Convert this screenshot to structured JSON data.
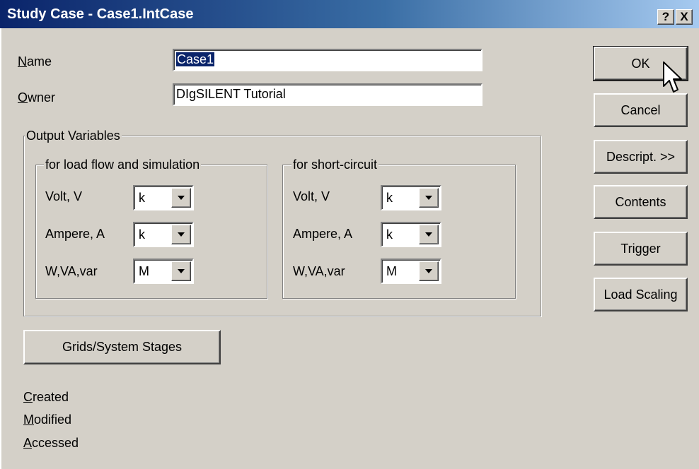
{
  "window": {
    "title": "Study Case - Case1.IntCase",
    "help_label": "?",
    "close_label": "X"
  },
  "fields": {
    "name": {
      "label_mnemonic": "N",
      "label_rest": "ame",
      "value": "Case1"
    },
    "owner": {
      "label_mnemonic": "O",
      "label_rest": "wner",
      "value": "DIgSILENT Tutorial"
    }
  },
  "output_variables": {
    "title": "Output Variables",
    "load_flow": {
      "title": "for load flow and simulation",
      "rows": [
        {
          "label": "Volt, V",
          "value": "k"
        },
        {
          "label": "Ampere, A",
          "value": "k"
        },
        {
          "label": "W,VA,var",
          "value": "M"
        }
      ]
    },
    "short_circuit": {
      "title": "for short-circuit",
      "rows": [
        {
          "label": "Volt, V",
          "value": "k"
        },
        {
          "label": "Ampere, A",
          "value": "k"
        },
        {
          "label": "W,VA,var",
          "value": "M"
        }
      ]
    }
  },
  "grids_button": "Grids/System Stages",
  "info": {
    "created": {
      "mnemonic": "C",
      "rest": "reated"
    },
    "modified": {
      "mnemonic": "M",
      "rest": "odified"
    },
    "accessed": {
      "mnemonic": "A",
      "rest": "ccessed"
    }
  },
  "buttons": {
    "ok": "OK",
    "cancel": "Cancel",
    "descript": "Descript. >>",
    "contents": "Contents",
    "trigger": "Trigger",
    "load_scaling": "Load Scaling"
  },
  "icons": {
    "dropdown": "chevron-down-icon",
    "cursor": "mouse-pointer-icon"
  }
}
